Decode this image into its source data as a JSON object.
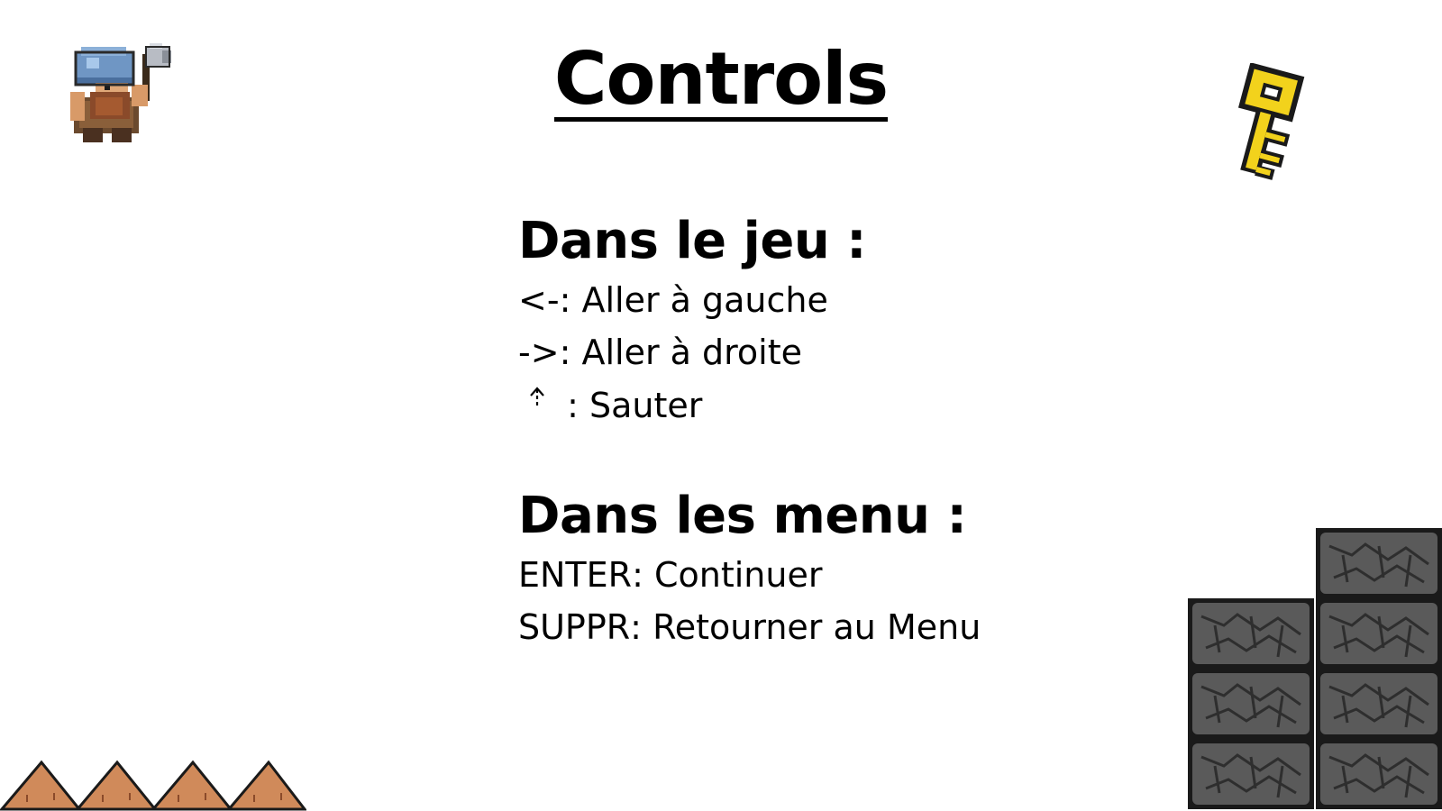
{
  "screen": {
    "title": "Controls"
  },
  "sections": {
    "in_game": {
      "heading": "Dans le jeu :",
      "controls": [
        {
          "key": "<- ",
          "sep": ": ",
          "action": "Aller à gauche"
        },
        {
          "key": "-> ",
          "sep": ": ",
          "action": "Aller à droite"
        },
        {
          "key_icon": "up-arrow-icon",
          "sep": " : ",
          "action": "Sauter"
        }
      ]
    },
    "in_menu": {
      "heading": "Dans les menu :",
      "controls": [
        {
          "key": "ENTER ",
          "sep": ": ",
          "action": "Continuer"
        },
        {
          "key": "SUPPR ",
          "sep": ": ",
          "action": "Retourner au Menu"
        }
      ]
    }
  },
  "decorations": {
    "dwarf": "dwarf-sprite",
    "key": "golden-key-sprite",
    "spikes": "spike-row-sprite",
    "stones": "stone-block-sprite"
  },
  "colors": {
    "background": "#ffffff",
    "text": "#000000",
    "key_gold": "#f2d21c",
    "stone": "#5a5a5a",
    "spike": "#d08a5a"
  }
}
